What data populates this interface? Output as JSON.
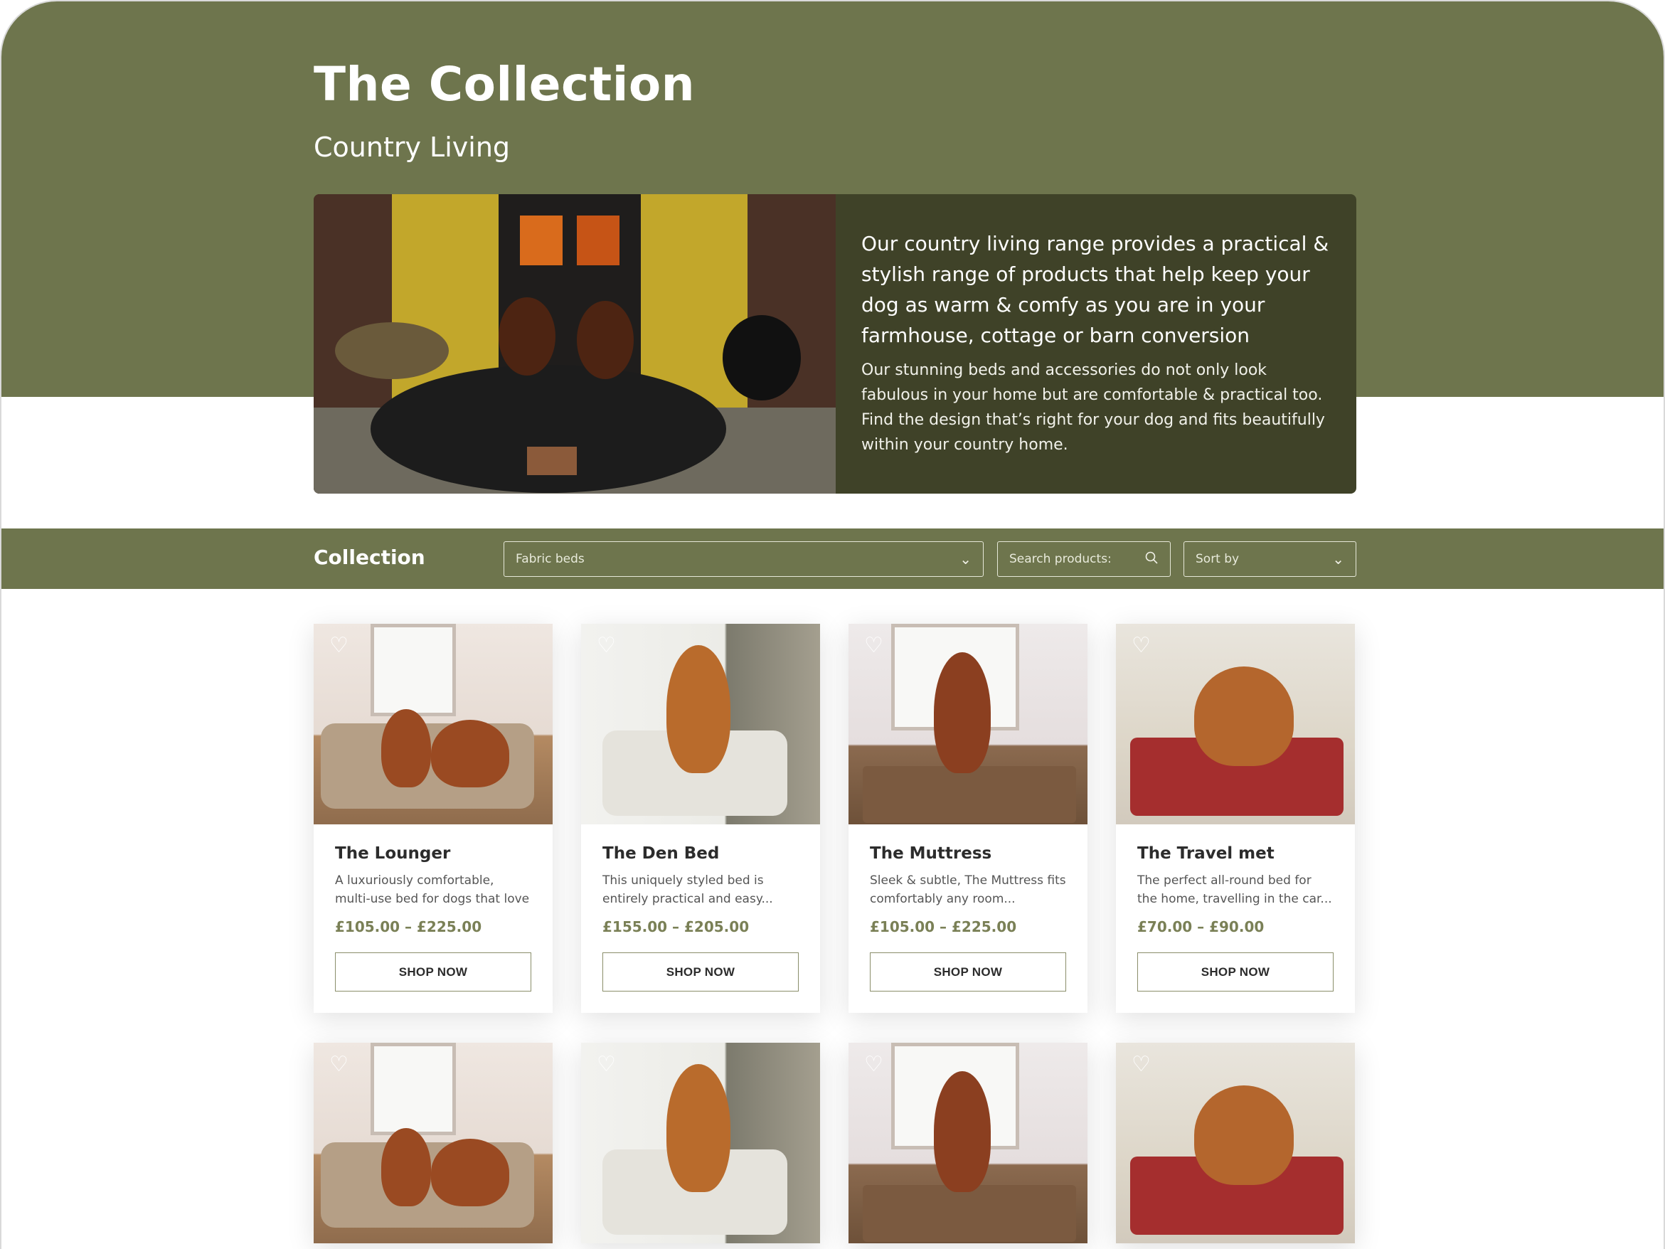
{
  "header": {
    "title": "The Collection",
    "subtitle": "Country Living"
  },
  "hero": {
    "lead": "Our country living range provides a practical & stylish range of products that help keep your dog as warm & comfy as you are in your farmhouse, cottage or barn conversion",
    "body": "Our stunning beds and accessories do not only look fabulous in your home but are comfortable & practical too. Find the design that’s right for your dog and fits beautifully within your country home."
  },
  "filters": {
    "title": "Collection",
    "category": "Fabric beds",
    "search_placeholder": "Search products:",
    "sort": "Sort by"
  },
  "products": [
    {
      "name": "The Lounger",
      "desc": "A luxuriously comfortable, multi-use bed for dogs that love",
      "price": "£105.00 – £225.00",
      "cta": "SHOP NOW"
    },
    {
      "name": "The Den Bed",
      "desc": "This uniquely styled bed is entirely practical and easy...",
      "price": "£155.00 – £205.00",
      "cta": "SHOP NOW"
    },
    {
      "name": "The Muttress",
      "desc": "Sleek & subtle, The Muttress fits comfortably any room...",
      "price": "£105.00 – £225.00",
      "cta": "SHOP NOW"
    },
    {
      "name": "The Travel met",
      "desc": "The perfect all-round bed for the home, travelling in the car...",
      "price": "£70.00 – £90.00",
      "cta": "SHOP NOW"
    }
  ],
  "icons": {
    "favorite": "heart-outline-icon",
    "search": "search-icon",
    "dropdown": "chevron-down-icon"
  },
  "colors": {
    "brand_olive": "#6e754d",
    "hero_panel": "#3f4228",
    "price": "#7a8056"
  }
}
